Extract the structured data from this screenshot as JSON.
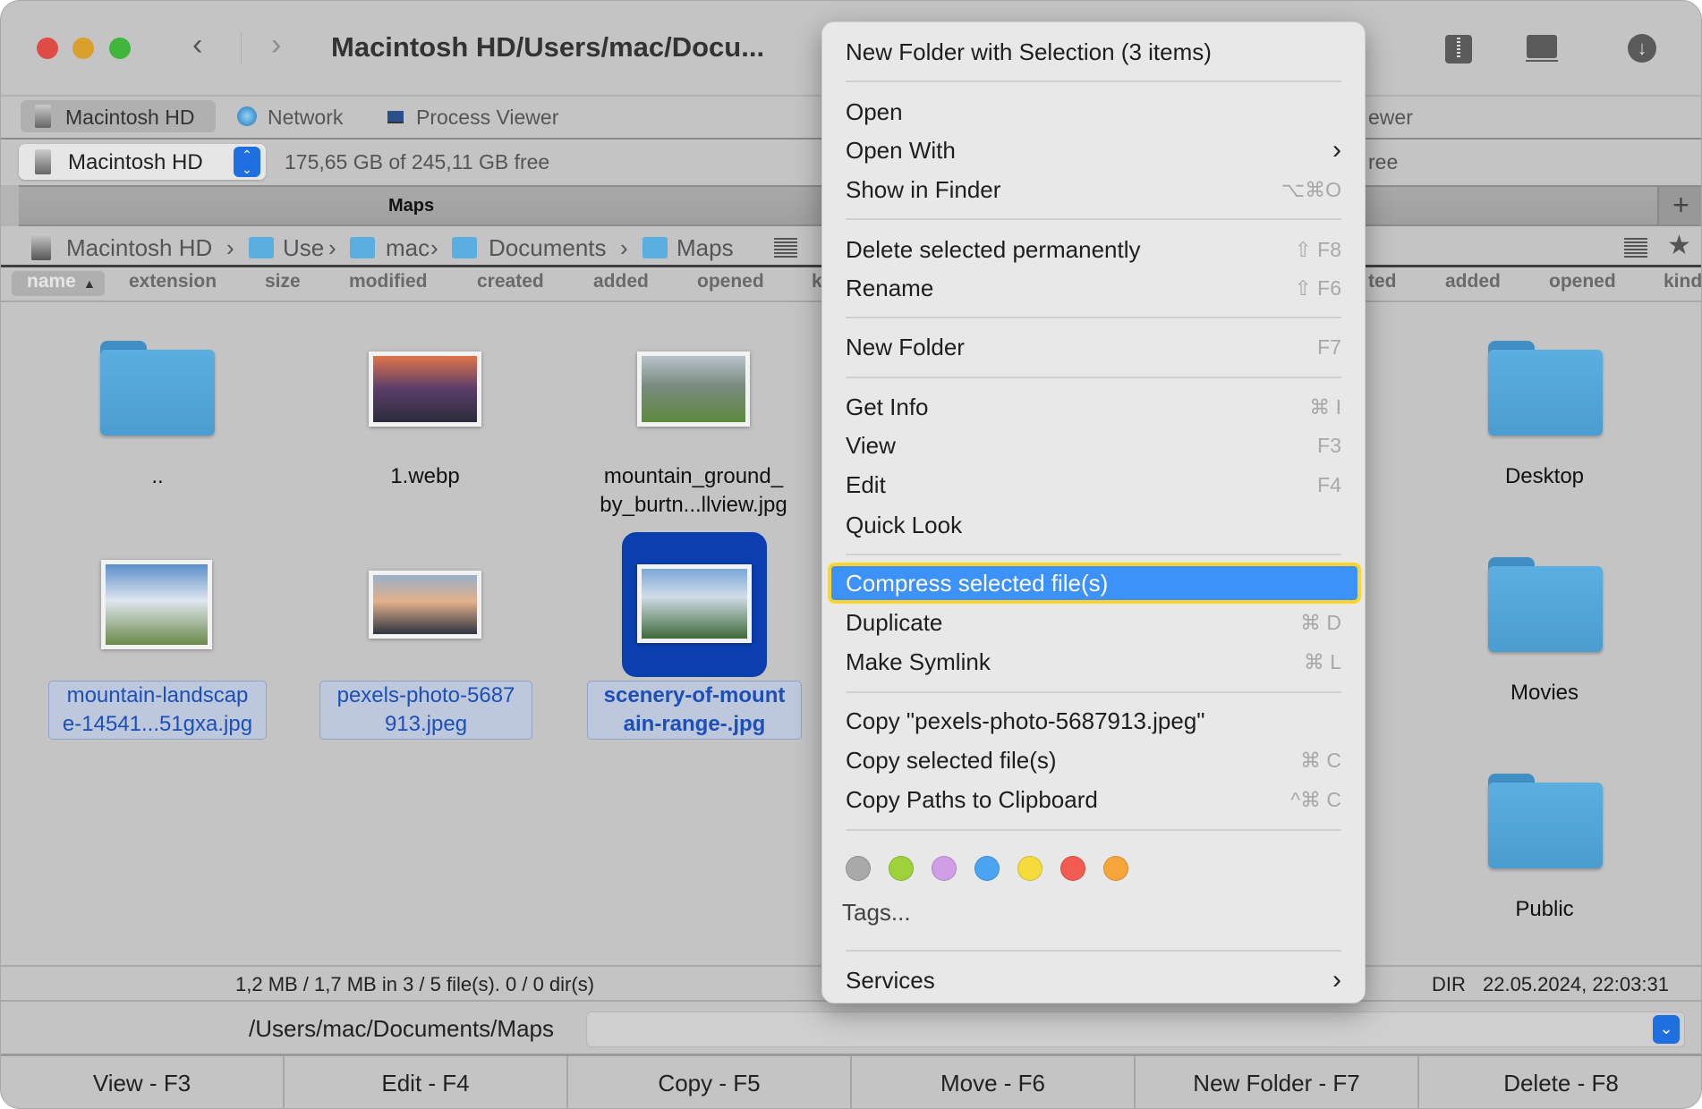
{
  "window": {
    "title": "Macintosh HD/Users/mac/Docu..."
  },
  "tabs": [
    {
      "label": "Macintosh HD"
    },
    {
      "label": "Network"
    },
    {
      "label": "Process Viewer"
    }
  ],
  "right_tabs_fragment": "ewer",
  "drive": {
    "name": "Macintosh HD",
    "free": "175,65 GB of 245,11 GB free",
    "right_fragment": "ree"
  },
  "panel": {
    "title": "Maps"
  },
  "breadcrumb": [
    {
      "label": "Macintosh HD"
    },
    {
      "label": "Use"
    },
    {
      "label": "mac"
    },
    {
      "label": "Documents"
    },
    {
      "label": "Maps"
    }
  ],
  "columns": [
    "name",
    "extension",
    "size",
    "modified",
    "created",
    "added",
    "opened",
    "k"
  ],
  "right_columns": [
    "ted",
    "added",
    "opened",
    "kind"
  ],
  "files": [
    {
      "name": "..",
      "type": "folder"
    },
    {
      "name": "1.webp",
      "type": "image"
    },
    {
      "name": "mountain_ground_\nby_burtn...llview.jpg",
      "type": "image"
    },
    {
      "name": "mountain-landscap\ne-14541...51gxa.jpg",
      "type": "image",
      "selected": true
    },
    {
      "name": "pexels-photo-5687\n913.jpeg",
      "type": "image",
      "selected": true
    },
    {
      "name": "scenery-of-mount\nain-range-.jpg",
      "type": "image",
      "selected": true,
      "focused": true
    }
  ],
  "right_files": [
    {
      "name": "Desktop"
    },
    {
      "name": "Movies"
    },
    {
      "name": "Public"
    }
  ],
  "status": {
    "left": "1,2 MB / 1,7 MB in 3 / 5 file(s). 0 / 0 dir(s)",
    "right_kind": "DIR",
    "right_date": "22.05.2024, 22:03:31"
  },
  "path": {
    "value": "/Users/mac/Documents/Maps"
  },
  "function_keys": [
    "View - F3",
    "Edit - F4",
    "Copy - F5",
    "Move - F6",
    "New Folder - F7",
    "Delete - F8"
  ],
  "context_menu": {
    "items": [
      {
        "label": "New Folder with Selection (3 items)",
        "shortcut": ""
      },
      {
        "label": "Open",
        "shortcut": ""
      },
      {
        "label": "Open With",
        "shortcut": "›"
      },
      {
        "label": "Show in Finder",
        "shortcut": "⌥⌘O"
      },
      {
        "label": "Delete selected permanently",
        "shortcut": "⇧ F8"
      },
      {
        "label": "Rename",
        "shortcut": "⇧ F6"
      },
      {
        "label": "New Folder",
        "shortcut": "F7"
      },
      {
        "label": "Get Info",
        "shortcut": "⌘ I"
      },
      {
        "label": "View",
        "shortcut": "F3"
      },
      {
        "label": "Edit",
        "shortcut": "F4"
      },
      {
        "label": "Quick Look",
        "shortcut": ""
      },
      {
        "label": "Compress selected file(s)",
        "shortcut": "",
        "highlighted": true
      },
      {
        "label": "Duplicate",
        "shortcut": "⌘ D"
      },
      {
        "label": "Make Symlink",
        "shortcut": "⌘ L"
      },
      {
        "label": "Copy \"pexels-photo-5687913.jpeg\"",
        "shortcut": ""
      },
      {
        "label": "Copy selected file(s)",
        "shortcut": "⌘ C"
      },
      {
        "label": "Copy Paths to Clipboard",
        "shortcut": "^⌘ C"
      },
      {
        "label": "Tags...",
        "shortcut": ""
      },
      {
        "label": "Services",
        "shortcut": "›"
      }
    ],
    "tag_colors": [
      "#a9a9a9",
      "#9ed13a",
      "#cf9ee6",
      "#4aa4f2",
      "#f5dc3c",
      "#f25c50",
      "#f5a53a"
    ],
    "highlight_color": "#3d92fa"
  }
}
